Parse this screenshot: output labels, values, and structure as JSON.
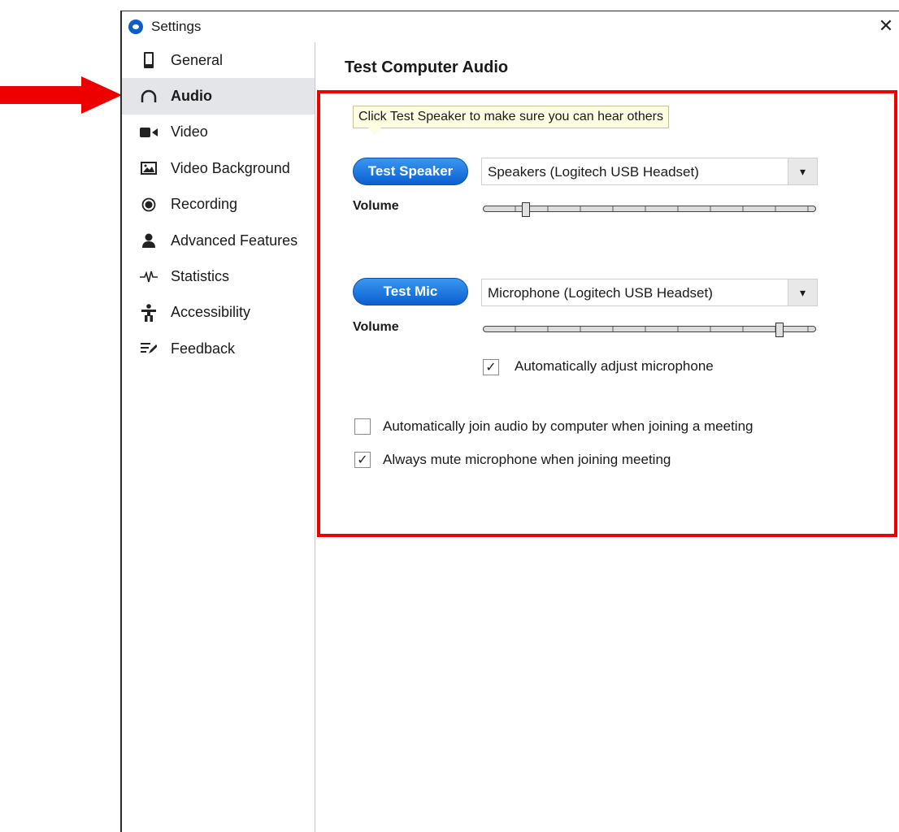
{
  "window": {
    "title": "Settings",
    "close_glyph": "✕"
  },
  "sidebar": {
    "items": [
      {
        "label": "General",
        "icon": "phone-icon"
      },
      {
        "label": "Audio",
        "icon": "headphones-icon",
        "active": true
      },
      {
        "label": "Video",
        "icon": "video-camera-icon"
      },
      {
        "label": "Video Background",
        "icon": "image-icon"
      },
      {
        "label": "Recording",
        "icon": "record-icon"
      },
      {
        "label": "Advanced Features",
        "icon": "person-icon"
      },
      {
        "label": "Statistics",
        "icon": "pulse-icon"
      },
      {
        "label": "Accessibility",
        "icon": "accessibility-icon"
      },
      {
        "label": "Feedback",
        "icon": "feedback-icon"
      }
    ]
  },
  "main": {
    "title": "Test Computer Audio",
    "tooltip": "Click Test Speaker to make sure you can hear others",
    "speaker": {
      "button_label": "Test Speaker",
      "device": "Speakers (Logitech USB Headset)",
      "volume_label": "Volume",
      "volume_level": 0.13
    },
    "mic": {
      "button_label": "Test Mic",
      "device": "Microphone (Logitech USB Headset)",
      "volume_label": "Volume",
      "volume_level": 0.89,
      "auto_adjust_label": "Automatically adjust microphone",
      "auto_adjust_checked": true
    },
    "options": [
      {
        "label": "Automatically join audio by computer when joining a meeting",
        "checked": false
      },
      {
        "label": "Always mute microphone when joining meeting",
        "checked": true
      }
    ],
    "dropdown_glyph": "▾",
    "check_glyph": "✓"
  },
  "colors": {
    "accent": "#0b5fd0",
    "highlight": "#ee0000",
    "arrow": "#ee0000",
    "active_bg": "#e4e5e8"
  }
}
